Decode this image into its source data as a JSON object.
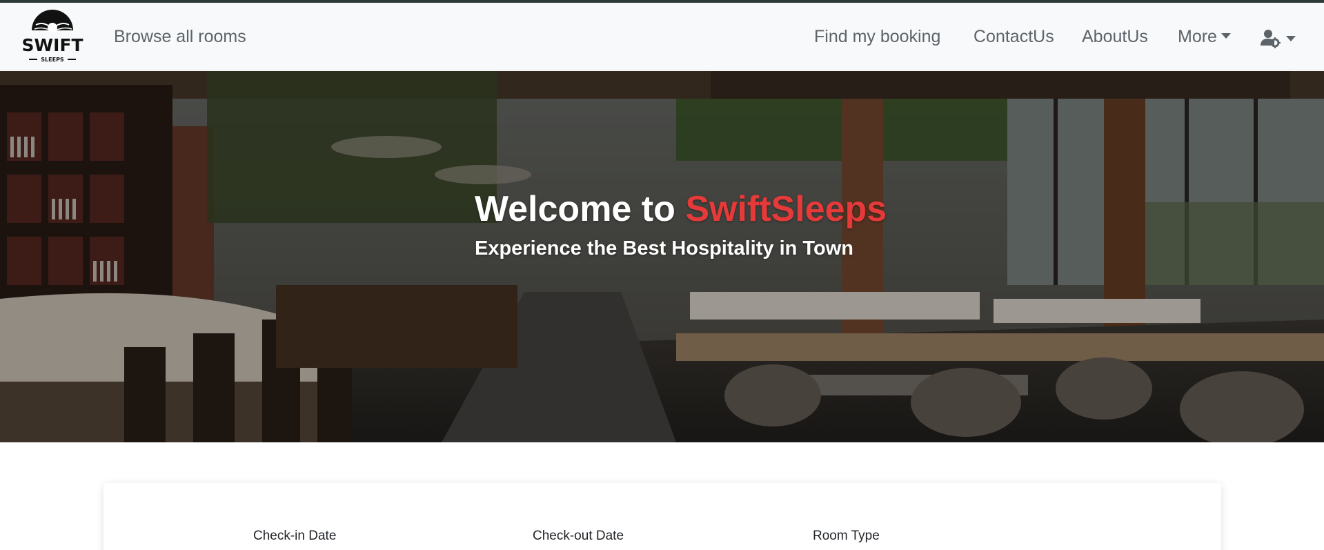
{
  "navbar": {
    "logo_text_main": "SWIFT",
    "logo_text_sub": "SLEEPS",
    "browse_label": "Browse all rooms",
    "find_booking_label": "Find my booking",
    "contact_label": "ContactUs",
    "about_label": "AboutUs",
    "more_label": "More",
    "user_menu_icon": "user-gear-icon"
  },
  "hero": {
    "title_prefix": "Welcome to ",
    "title_brand": "SwiftSleeps",
    "subtitle": "Experience the Best Hospitality in Town",
    "brand_color": "#e63a3a"
  },
  "booking": {
    "checkin_label": "Check-in Date",
    "checkout_label": "Check-out Date",
    "room_type_label": "Room Type"
  }
}
